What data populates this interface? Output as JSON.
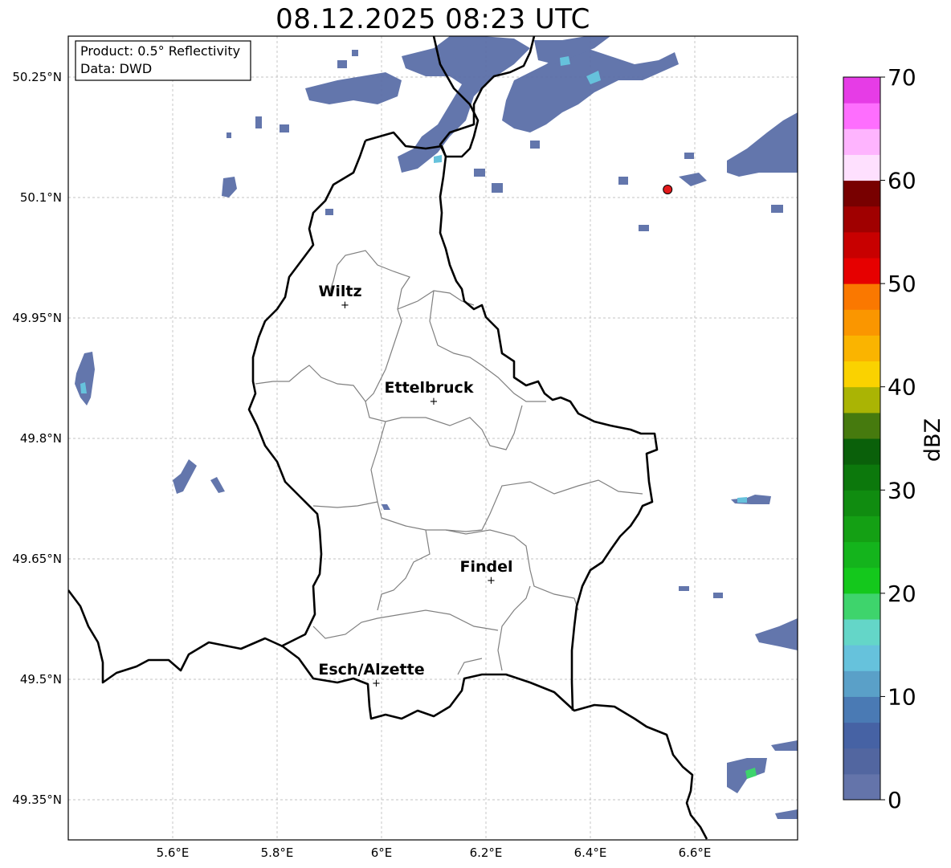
{
  "title": "08.12.2025 08:23 UTC",
  "info_box": {
    "product": "Product: 0.5° Reflectivity",
    "data": "Data: DWD"
  },
  "map": {
    "lon_range": [
      5.4,
      6.8
    ],
    "lat_range": [
      49.3,
      50.3
    ],
    "x_ticks": [
      {
        "value": 5.6,
        "label": "5.6°E"
      },
      {
        "value": 5.8,
        "label": "5.8°E"
      },
      {
        "value": 6.0,
        "label": "6°E"
      },
      {
        "value": 6.2,
        "label": "6.2°E"
      },
      {
        "value": 6.4,
        "label": "6.4°E"
      },
      {
        "value": 6.6,
        "label": "6.6°E"
      }
    ],
    "y_ticks": [
      {
        "value": 50.25,
        "label": "50.25°N"
      },
      {
        "value": 50.1,
        "label": "50.1°N"
      },
      {
        "value": 49.95,
        "label": "49.95°N"
      },
      {
        "value": 49.8,
        "label": "49.8°N"
      },
      {
        "value": 49.65,
        "label": "49.65°N"
      },
      {
        "value": 49.5,
        "label": "49.5°N"
      },
      {
        "value": 49.35,
        "label": "49.35°N"
      }
    ],
    "cities": [
      {
        "name": "Wiltz",
        "lon": 5.93,
        "lat": 49.967
      },
      {
        "name": "Ettelbruck",
        "lon": 6.1,
        "lat": 49.847
      },
      {
        "name": "Findel",
        "lon": 6.21,
        "lat": 49.624
      },
      {
        "name": "Esch/Alzette",
        "lon": 5.99,
        "lat": 49.496
      }
    ],
    "radar_site": {
      "lon": 6.548,
      "lat": 50.11,
      "color": "#e31a1c"
    }
  },
  "colorbar": {
    "label": "dBZ",
    "min": 0,
    "max": 70,
    "tick_labels": [
      "0",
      "10",
      "20",
      "30",
      "40",
      "50",
      "60",
      "70"
    ],
    "colors": [
      "#6474aa",
      "#5266a0",
      "#4662a4",
      "#4a7ab4",
      "#5aa0c8",
      "#66c2dc",
      "#64d6c8",
      "#3ed46c",
      "#14c81c",
      "#14b41c",
      "#14a014",
      "#108c10",
      "#0c780c",
      "#0a600a",
      "#467a0e",
      "#aab404",
      "#fad200",
      "#fab400",
      "#fa9600",
      "#fa7800",
      "#e60000",
      "#c80000",
      "#a00000",
      "#780000",
      "#fee0fe",
      "#feb4fe",
      "#fe6efe",
      "#e63ce6"
    ]
  }
}
